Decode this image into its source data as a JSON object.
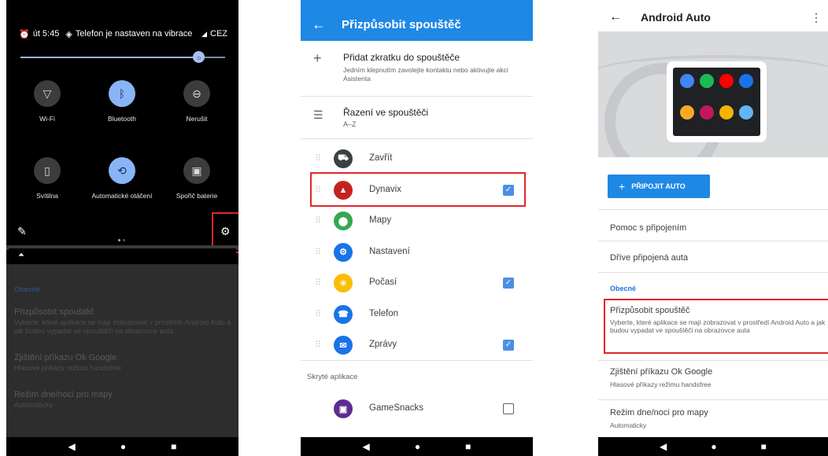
{
  "panel1": {
    "status": {
      "time": "út 5:45",
      "vibrate_text": "Telefon je nastaven na vibrace",
      "carrier": "CEZ"
    },
    "brightness_level": 0.87,
    "tiles": [
      {
        "label": "Wi-Fi",
        "icon": "wifi-icon",
        "on": false
      },
      {
        "label": "Bluetooth",
        "icon": "bluetooth-icon",
        "on": true
      },
      {
        "label": "Nerušit",
        "icon": "dnd-icon",
        "on": false
      },
      {
        "label": "Svítilna",
        "icon": "flashlight-icon",
        "on": false
      },
      {
        "label": "Automatické otáčení",
        "icon": "rotate-icon",
        "on": true
      },
      {
        "label": "Spořič baterie",
        "icon": "battery-saver-icon",
        "on": false
      }
    ],
    "dimmed": {
      "section": "Obecné",
      "items": [
        {
          "title": "Přizpůsobit spouštěč",
          "subtitle": "Vyberte, které aplikace se mají zobrazovat v prostředí Android Auto a jak budou vypadat ve spouštěči na obrazovce auta"
        },
        {
          "title": "Zjištění příkazu Ok Google",
          "subtitle": "Hlasové příkazy režimu handsfree"
        },
        {
          "title": "Režim dne/noci pro mapy",
          "subtitle": "Automaticky"
        }
      ]
    }
  },
  "panel2": {
    "title": "Přizpůsobit spouštěč",
    "add_shortcut": {
      "title": "Přidat zkratku do spouštěče",
      "subtitle": "Jedním klepnutím zavolejte kontaktu nebo aktivujte akci Asistenta"
    },
    "sort": {
      "title": "Řazení ve spouštěči",
      "value": "A–Z"
    },
    "apps": [
      {
        "name": "Zavřít",
        "color": "#3c4043",
        "glyph": "⛟",
        "checkbox": null
      },
      {
        "name": "Dynavix",
        "color": "#c5221f",
        "glyph": "▲",
        "checkbox": true
      },
      {
        "name": "Mapy",
        "color": "#34a853",
        "glyph": "⬤",
        "checkbox": null
      },
      {
        "name": "Nastavení",
        "color": "#1a73e8",
        "glyph": "⚙",
        "checkbox": null
      },
      {
        "name": "Počasí",
        "color": "#fbbc04",
        "glyph": "☀",
        "checkbox": true
      },
      {
        "name": "Telefon",
        "color": "#1a73e8",
        "glyph": "☎",
        "checkbox": null
      },
      {
        "name": "Zprávy",
        "color": "#1a73e8",
        "glyph": "✉",
        "checkbox": true
      }
    ],
    "hidden_header": "Skryté aplikace",
    "hidden_apps": [
      {
        "name": "GameSnacks",
        "color": "#5c2d91",
        "glyph": "▣",
        "checkbox": false
      }
    ]
  },
  "panel3": {
    "title": "Android Auto",
    "connect_button": "PŘIPOJIT AUTO",
    "hero_app_colors": [
      "#4285f4",
      "#1db954",
      "#ff0000",
      "#1a73e8",
      "#f9a825",
      "#c2185b",
      "#f4b400",
      "#64b5f6"
    ],
    "items": [
      {
        "title": "Pomoc s připojením",
        "subtitle": ""
      },
      {
        "title": "Dříve připojená auta",
        "subtitle": ""
      }
    ],
    "section": "Obecné",
    "launcher": {
      "title": "Přizpůsobit spouštěč",
      "subtitle": "Vyberte, které aplikace se mají zobrazovat v prostředí Android Auto a jak budou vypadat ve spouštěči na obrazovce auta"
    },
    "ok_google": {
      "title": "Zjištění příkazu Ok Google",
      "subtitle": "Hlasové příkazy režimu handsfree"
    },
    "day_night": {
      "title": "Režim dne/noci pro mapy",
      "subtitle": "Automaticky"
    }
  }
}
